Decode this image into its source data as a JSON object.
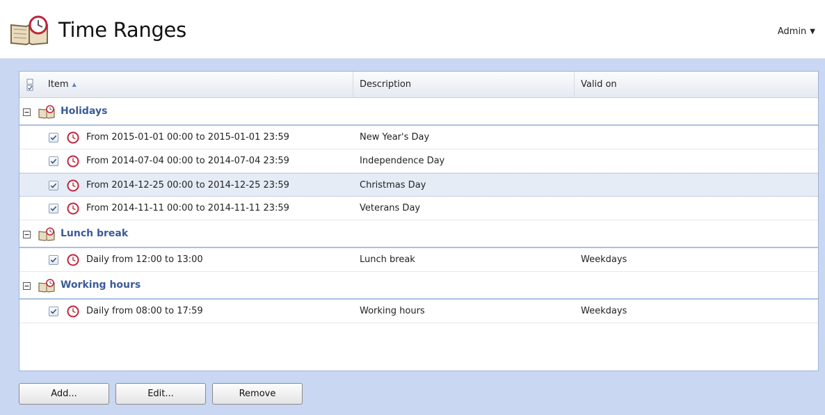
{
  "header": {
    "title": "Time Ranges",
    "user_menu": "Admin",
    "caret": "▼"
  },
  "table": {
    "columns": {
      "item": "Item",
      "description": "Description",
      "valid_on": "Valid on"
    },
    "sort": {
      "column": "Item",
      "direction": "ascending",
      "glyph": "▲"
    },
    "groups": [
      {
        "name": "Holidays",
        "expanded": true,
        "rows": [
          {
            "range": "From 2015-01-01 00:00 to 2015-01-01 23:59",
            "description": "New Year's Day",
            "valid_on": "",
            "checked": true,
            "selected": false
          },
          {
            "range": "From 2014-07-04 00:00 to 2014-07-04 23:59",
            "description": "Independence Day",
            "valid_on": "",
            "checked": true,
            "selected": false
          },
          {
            "range": "From 2014-12-25 00:00 to 2014-12-25 23:59",
            "description": "Christmas Day",
            "valid_on": "",
            "checked": true,
            "selected": true
          },
          {
            "range": "From 2014-11-11 00:00 to 2014-11-11 23:59",
            "description": "Veterans Day",
            "valid_on": "",
            "checked": true,
            "selected": false
          }
        ]
      },
      {
        "name": "Lunch break",
        "expanded": true,
        "rows": [
          {
            "range": "Daily from 12:00 to 13:00",
            "description": "Lunch break",
            "valid_on": "Weekdays",
            "checked": true,
            "selected": false
          }
        ]
      },
      {
        "name": "Working hours",
        "expanded": true,
        "rows": [
          {
            "range": "Daily from 08:00 to 17:59",
            "description": "Working hours",
            "valid_on": "Weekdays",
            "checked": true,
            "selected": false
          }
        ]
      }
    ]
  },
  "buttons": {
    "add": "Add...",
    "edit": "Edit...",
    "remove": "Remove"
  },
  "icons": {
    "app": "calendar-book-clock-icon",
    "group": "calendar-book-clock-icon",
    "row": "clock-icon",
    "toggle": "collapse-minus-icon",
    "select_all": "select-all-checkbox-icon"
  },
  "colors": {
    "accent": "#3b5a9a",
    "panel_background": "#c9d7f2",
    "selected_row": "#e6ecf6",
    "clock": "#c0243c"
  }
}
